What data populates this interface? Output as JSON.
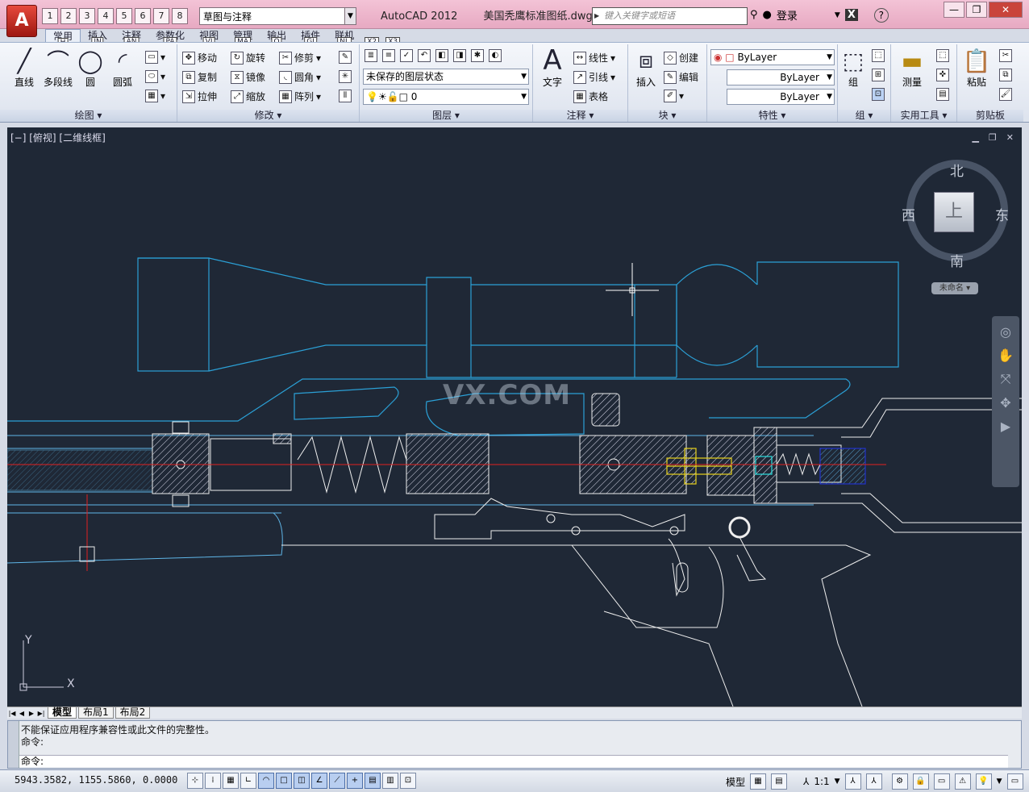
{
  "app": {
    "logo": "A",
    "workspace": "草图与注释",
    "title": "AutoCAD 2012",
    "filename": "美国秃鹰标准图纸.dwg",
    "search_placeholder": "键入关键字或短语",
    "login": "登录"
  },
  "qat_keys": [
    "1",
    "2",
    "3",
    "4",
    "5",
    "6",
    "7",
    "8"
  ],
  "menu_tabs": [
    {
      "label": "常用",
      "key": "H"
    },
    {
      "label": "插入",
      "key": "IN"
    },
    {
      "label": "注释",
      "key": "AN"
    },
    {
      "label": "参数化",
      "key": "PA"
    },
    {
      "label": "视图",
      "key": "VI"
    },
    {
      "label": "管理",
      "key": "MA"
    },
    {
      "label": "输出",
      "key": "O"
    },
    {
      "label": "插件",
      "key": "GI"
    },
    {
      "label": "联机",
      "key": "NL"
    },
    {
      "label": "",
      "key": "X2"
    },
    {
      "label": "",
      "key": "X3"
    }
  ],
  "ribbon": {
    "draw": {
      "label": "绘图",
      "line": "直线",
      "polyline": "多段线",
      "circle": "圆",
      "arc": "圆弧"
    },
    "modify": {
      "label": "修改",
      "move": "移动",
      "rotate": "旋转",
      "trim": "修剪",
      "copy": "复制",
      "mirror": "镜像",
      "fillet": "圆角",
      "stretch": "拉伸",
      "scale": "缩放",
      "array": "阵列"
    },
    "layers": {
      "label": "图层",
      "state": "未保存的图层状态",
      "current": "0"
    },
    "annotation": {
      "label": "注释",
      "text": "文字",
      "linear": "线性",
      "leader": "引线",
      "table": "表格"
    },
    "block": {
      "label": "块",
      "insert": "插入",
      "create": "创建",
      "edit": "编辑"
    },
    "properties": {
      "label": "特性",
      "color": "ByLayer",
      "linetype": "ByLayer",
      "lineweight": "ByLayer"
    },
    "groups": {
      "label": "组",
      "group": "组"
    },
    "utilities": {
      "label": "实用工具",
      "measure": "测量"
    },
    "clipboard": {
      "label": "剪贴板",
      "paste": "粘贴"
    }
  },
  "viewport": {
    "label": "[−] [俯视] [二维线框]",
    "watermark": "VX.COM",
    "viewcube": {
      "north": "北",
      "south": "南",
      "east": "东",
      "west": "西",
      "face": "上",
      "ucs": "未命名"
    },
    "ucs_x": "X",
    "ucs_y": "Y"
  },
  "layout_tabs": [
    "模型",
    "布局1",
    "布局2"
  ],
  "command": {
    "line1": "不能保证应用程序兼容性或此文件的完整性。",
    "line2": "命令:",
    "prompt": "命令:"
  },
  "status": {
    "coords": "5943.3582, 1155.5860, 0.0000",
    "model": "模型",
    "scale": "1:1"
  },
  "colors": {
    "canvas": "#1f2836",
    "scope": "#2ba0d6",
    "barrel": "#5fb6e8",
    "crosshair": "#ffffff",
    "centerline": "#e02020",
    "brass": "#e8d21c",
    "cyan": "#28e0e0",
    "blue": "#2233cc"
  }
}
